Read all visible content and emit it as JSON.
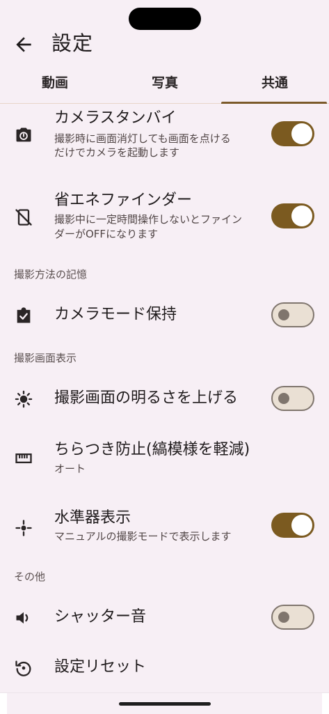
{
  "header": {
    "title": "設定"
  },
  "tabs": [
    {
      "label": "動画"
    },
    {
      "label": "写真"
    },
    {
      "label": "共通",
      "selected": true
    }
  ],
  "rows": [
    {
      "title": "カメラスタンバイ",
      "sub1": "撮影時に画面消灯しても画面を点ける",
      "sub2": "だけでカメラを起動します",
      "icon": "camera-timer-icon",
      "toggle": true
    },
    {
      "title": "省エネファインダー",
      "sub1": "撮影中に一定時間操作しないとファイン",
      "sub2": "ダーがOFFになります",
      "icon": "phone-off-icon",
      "toggle": true
    },
    {
      "title": "カメラモード保持",
      "icon": "clipboard-check-icon",
      "toggle": false
    },
    {
      "title": "撮影画面の明るさを上げる",
      "icon": "brightness-icon",
      "toggle": false
    },
    {
      "title": "ちらつき防止(縞模様を軽減)",
      "sub1": "オート",
      "icon": "flicker-icon"
    },
    {
      "title": "水準器表示",
      "sub1": "マニュアルの撮影モードで表示します",
      "icon": "level-icon",
      "toggle": true
    },
    {
      "title": "シャッター音",
      "icon": "speaker-icon",
      "toggle": false
    },
    {
      "title": "設定リセット",
      "icon": "reset-icon"
    }
  ],
  "sections": {
    "memory": "撮影方法の記憶",
    "display": "撮影画面表示",
    "other": "その他"
  },
  "colors": {
    "accent": "#7b5a20",
    "background": "#f7eff5"
  }
}
